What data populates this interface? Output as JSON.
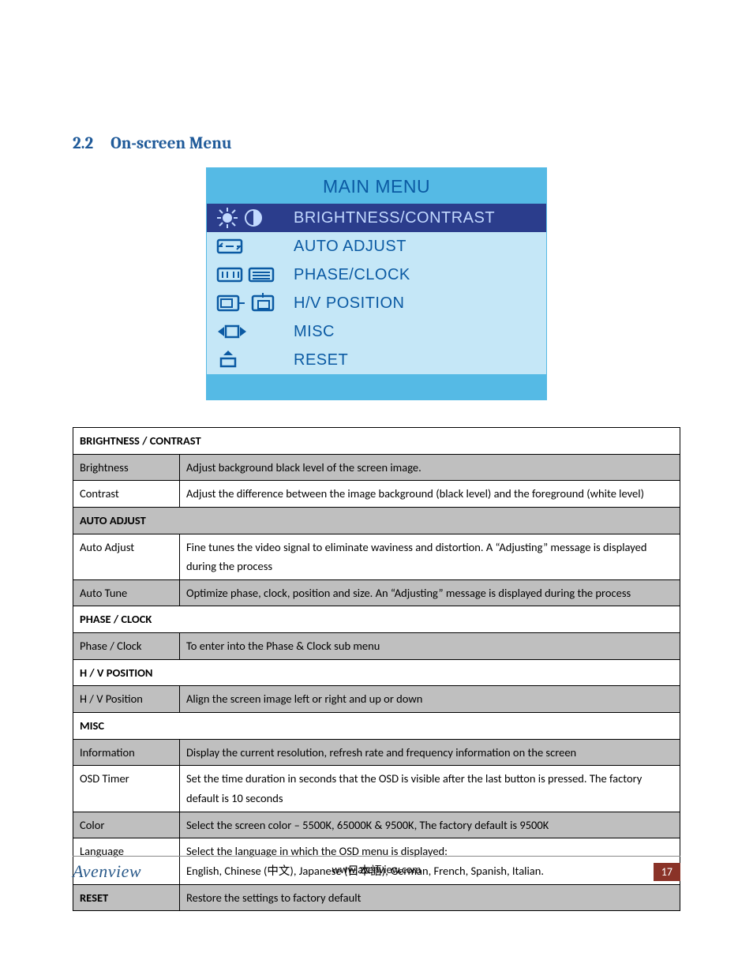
{
  "heading": {
    "number": "2.2",
    "title": "On-screen Menu"
  },
  "osd": {
    "title": "MAIN MENU",
    "items": [
      {
        "label": "BRIGHTNESS/CONTRAST",
        "selected": true,
        "icon": "brightness-contrast"
      },
      {
        "label": "AUTO ADJUST",
        "selected": false,
        "icon": "auto-adjust"
      },
      {
        "label": "PHASE/CLOCK",
        "selected": false,
        "icon": "phase-clock"
      },
      {
        "label": "H/V POSITION",
        "selected": false,
        "icon": "hv-position"
      },
      {
        "label": "MISC",
        "selected": false,
        "icon": "misc"
      },
      {
        "label": "RESET",
        "selected": false,
        "icon": "reset"
      }
    ]
  },
  "table": {
    "sections": [
      {
        "header": "BRIGHTNESS / CONTRAST",
        "header_shaded": false,
        "header_colspan": 2,
        "rows": [
          {
            "shaded": true,
            "label": "Brightness",
            "desc": "Adjust background black level of the screen image."
          },
          {
            "shaded": false,
            "label": "Contrast",
            "desc": "Adjust the difference between the image background (black level) and the foreground (white level)"
          }
        ]
      },
      {
        "header": "AUTO ADJUST",
        "header_shaded": true,
        "header_colspan": 2,
        "rows": [
          {
            "shaded": false,
            "label": "Auto Adjust",
            "desc": "Fine tunes the video signal to eliminate waviness and distortion. A “Adjusting” message is displayed during the process"
          },
          {
            "shaded": true,
            "label": "Auto Tune",
            "desc": "Optimize phase, clock, position and size. An “Adjusting” message is displayed during the process"
          }
        ]
      },
      {
        "header": "PHASE / CLOCK",
        "header_shaded": false,
        "header_colspan": 2,
        "rows": [
          {
            "shaded": true,
            "label": "Phase / Clock",
            "desc": "To enter into the Phase & Clock sub menu"
          }
        ]
      },
      {
        "header": "H / V POSITION",
        "header_shaded": false,
        "header_colspan": 2,
        "rows": [
          {
            "shaded": true,
            "label": "H / V Position",
            "desc": "Align the screen image left or right and up or down"
          }
        ]
      },
      {
        "header": "MISC",
        "header_shaded": false,
        "header_colspan": 2,
        "rows": [
          {
            "shaded": true,
            "label": "Information",
            "desc": "Display the current resolution, refresh rate and frequency information on the screen"
          },
          {
            "shaded": false,
            "label": "OSD Timer",
            "desc": "Set the time duration in seconds that the OSD is visible after the last button is pressed. The factory default is 10 seconds"
          },
          {
            "shaded": true,
            "label": "Color",
            "desc": "Select the screen color – 5500K, 65000K & 9500K, The factory default is 9500K"
          },
          {
            "shaded": false,
            "label": "Language",
            "desc": "Select the language in which the OSD menu is displayed:\nEnglish, Chinese (中文), Japanese (日本語), German, French, Spanish, Italian."
          }
        ]
      },
      {
        "header": "RESET",
        "header_shaded": true,
        "header_colspan": 1,
        "header_desc": "Restore the settings to factory default",
        "rows": []
      }
    ]
  },
  "footer": {
    "logo": "Avenview",
    "url": "www.avenview.com",
    "page": "17"
  }
}
